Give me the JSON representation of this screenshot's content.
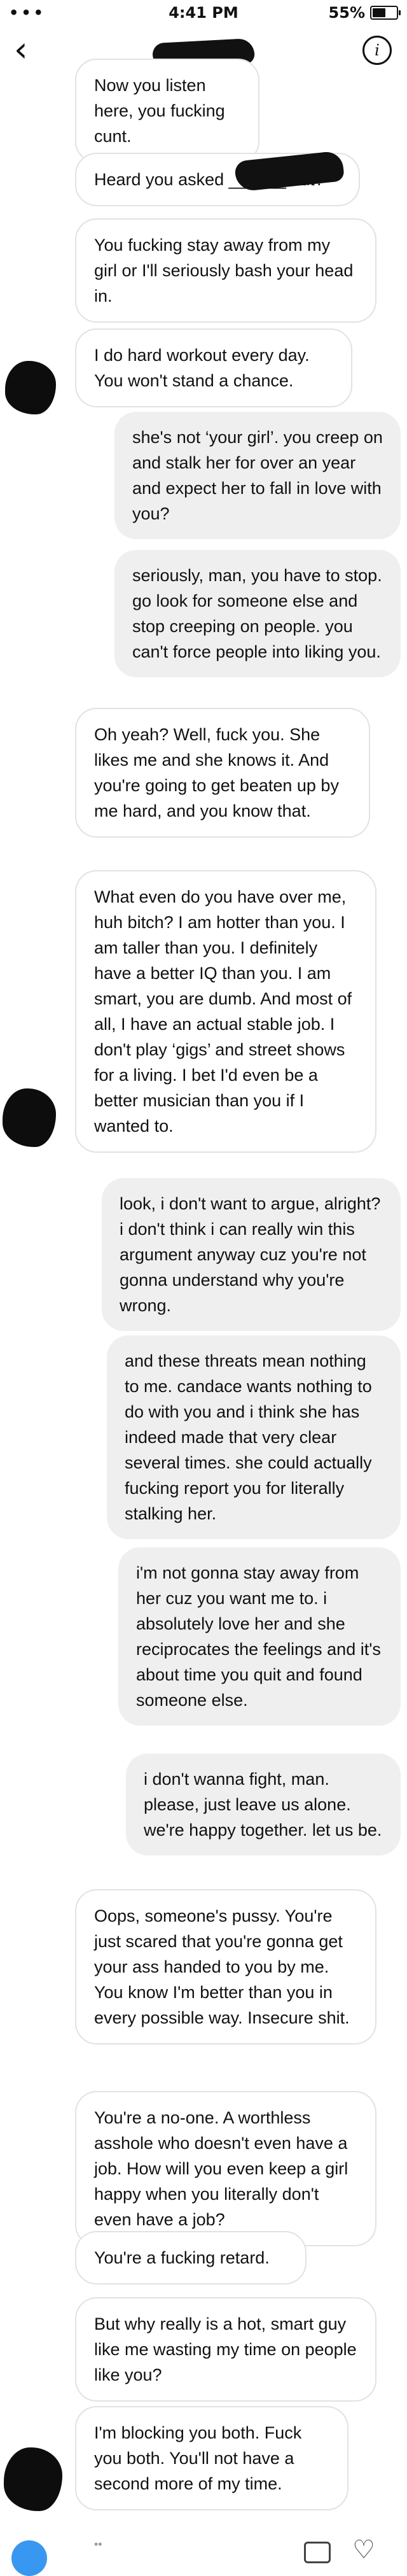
{
  "status_bar": {
    "signal": "•••",
    "time": "4:41 PM",
    "battery_text": "55%",
    "battery_level": 0.55
  },
  "header": {
    "back_icon": "‹",
    "info_icon": "i"
  },
  "messages": [
    {
      "side": "in",
      "text": "Now you listen here, you fucking cunt."
    },
    {
      "side": "in",
      "text": "Heard you asked ______ out?"
    },
    {
      "side": "in",
      "text": "You fucking stay away from my girl or I'll seriously bash your head in."
    },
    {
      "side": "in",
      "text": "I do hard workout every day. You won't stand a chance."
    },
    {
      "side": "out",
      "text": "she's not ‘your girl’. you creep on and stalk her for over an year and expect her to fall in love with you?"
    },
    {
      "side": "out",
      "text": "seriously, man, you have to stop. go look for someone else and stop creeping on people. you can't force people into liking you."
    },
    {
      "side": "in",
      "text": "Oh yeah? Well, fuck you. She likes me and she knows it. And you're going to get beaten up by me hard, and you know that."
    },
    {
      "side": "in",
      "text": "What even do you have over me, huh bitch? I am hotter than you. I am taller than you. I definitely have a better IQ than you. I am smart, you are dumb. And most of all, I have an actual stable job. I don't play ‘gigs’ and street shows for a living. I bet I'd even be a better musician than you if I wanted to."
    },
    {
      "side": "out",
      "text": "look, i don't want to argue, alright? i don't think i can really win this argument anyway cuz you're not gonna understand why you're wrong."
    },
    {
      "side": "out",
      "text": "and these threats mean nothing to me. candace wants nothing to do with you and i think she has indeed made that very clear several times. she could actually fucking report you for literally stalking her."
    },
    {
      "side": "out",
      "text": "i'm not gonna stay away from her cuz you want me to. i absolutely love her and she reciprocates the feelings and it's about time you quit and found someone else."
    },
    {
      "side": "out",
      "text": "i don't wanna fight, man. please, just leave us alone. we're happy together. let us be."
    },
    {
      "side": "in",
      "text": "Oops, someone's pussy. You're just scared that you're gonna get your ass handed to you by me. You know I'm better than you in every possible way. Insecure shit."
    },
    {
      "side": "in",
      "text": "You're a no-one. A worthless asshole who doesn't even have a job. How will you even keep a girl happy when you literally don't even have a job?"
    },
    {
      "side": "in",
      "text": "You're a fucking retard."
    },
    {
      "side": "in",
      "text": "But why really is a hot, smart guy like me wasting my time on people like you?"
    },
    {
      "side": "in",
      "text": "I'm blocking you both. Fuck you both. You'll not have a second more of my time."
    }
  ],
  "composer": {
    "dots": "••",
    "heart_icon": "♡"
  }
}
